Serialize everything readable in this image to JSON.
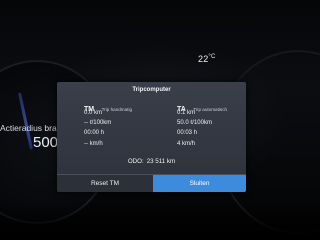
{
  "status": {
    "temperature": "22",
    "temperature_unit": "°C"
  },
  "background": {
    "range_label": "Actieradius brand",
    "range_value": "500"
  },
  "tripcomputer": {
    "title": "Tripcomputer",
    "trip_left": {
      "code": "TM",
      "subtitle": "Trip handmatig",
      "values": [
        "0.0 km",
        "-- ℓ/100km",
        "00:00 h",
        "-- km/h"
      ]
    },
    "trip_right": {
      "code": "TA",
      "subtitle": "Trip automatisch",
      "values": [
        "0.1 km",
        "50.0 ℓ/100km",
        "00:03 h",
        "4 km/h"
      ]
    },
    "odometer_label": "ODO:",
    "odometer_value": "23 511 km",
    "reset_label": "Reset TM",
    "close_label": "Sluiten"
  },
  "colors": {
    "accent": "#3d8bdc",
    "popup_bg": "#333842"
  }
}
